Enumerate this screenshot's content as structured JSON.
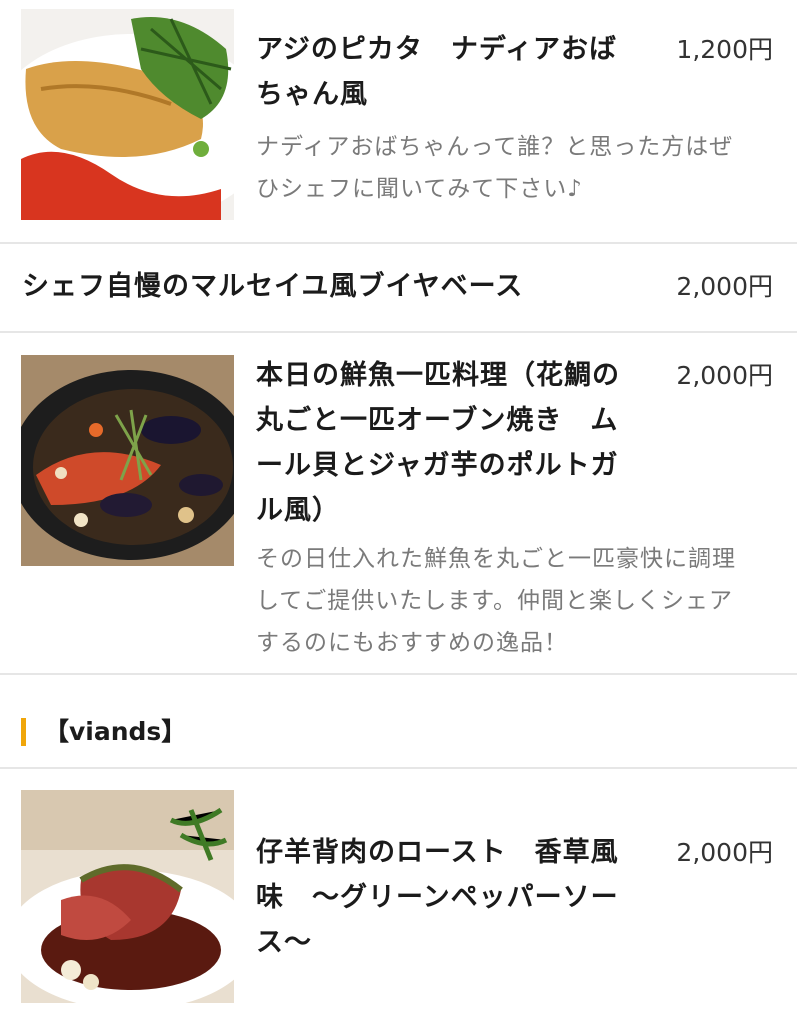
{
  "colors": {
    "accent": "#f0a60a",
    "divider": "#e6e6e6",
    "description": "#7a7a7a"
  },
  "items": [
    {
      "name_lines": [
        "アジのピカタ　ナディアおば",
        "ちゃん風"
      ],
      "price": "1,200円",
      "description_lines": [
        "ナディアおばちゃんって誰？と思った方はぜ",
        "ひシェフに聞いてみて下さい♪"
      ],
      "image": "fish-piccata-photo"
    },
    {
      "name": "シェフ自慢のマルセイユ風ブイヤベース",
      "price": "2,000円"
    },
    {
      "name_lines": [
        "本日の鮮魚一匹料理（花鯛の",
        "丸ごと一匹オーブン焼き　ム",
        "ール貝とジャガ芋のポルトガ",
        "ル風）"
      ],
      "price": "2,000円",
      "description_lines": [
        "その日仕入れた鮮魚を丸ごと一匹豪快に調理",
        "してご提供いたします。仲間と楽しくシェア",
        "するのにもおすすめの逸品！"
      ],
      "image": "whole-fish-pan-photo"
    }
  ],
  "section": {
    "title": "【viands】"
  },
  "meat_items": [
    {
      "name_lines": [
        "仔羊背肉のロースト　香草風",
        "味　〜グリーンペッパーソー",
        "ス〜"
      ],
      "price": "2,000円",
      "image": "roast-lamb-photo"
    }
  ]
}
